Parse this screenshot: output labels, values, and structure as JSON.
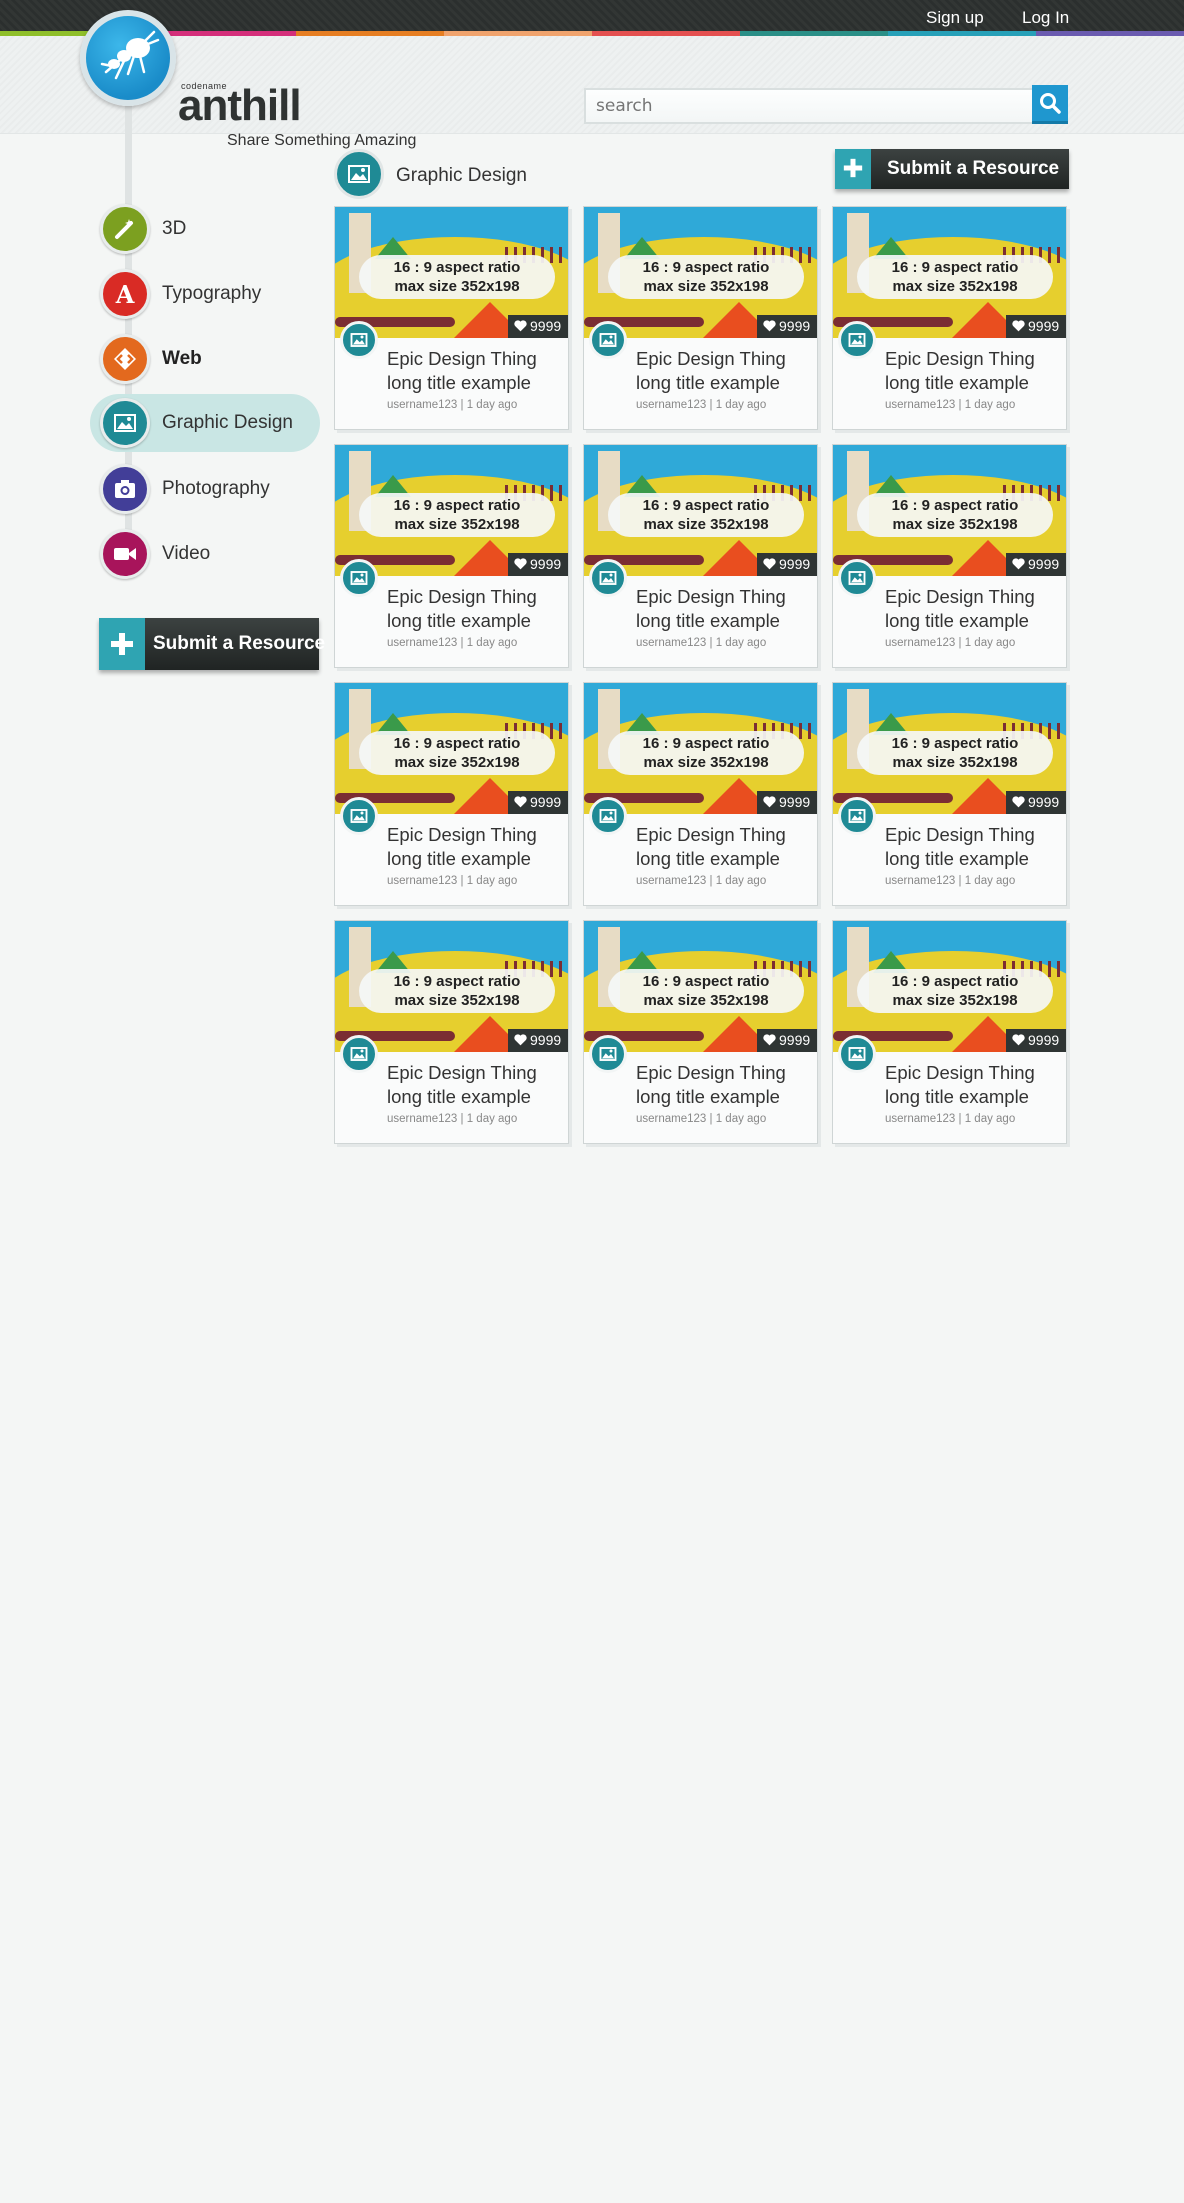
{
  "topbar": {
    "signup_label": "Sign up",
    "login_label": "Log In",
    "stripe_colors": [
      "#8fbf2a",
      "#d42f7b",
      "#e67e22",
      "#f0a36d",
      "#e45050",
      "#2a8f87",
      "#26a0b8",
      "#6a5bb0"
    ]
  },
  "header": {
    "logo_small": "codename",
    "logo_name": "anthill",
    "tagline": "Share Something Amazing",
    "search_placeholder": "search"
  },
  "sidebar": {
    "items": [
      {
        "label": "3D",
        "icon": "wand-icon",
        "color": "#7ca020"
      },
      {
        "label": "Typography",
        "icon": "letter-a-icon",
        "color": "#d92b25"
      },
      {
        "label": "Web",
        "icon": "code-diamond-icon",
        "color": "#e3691e"
      },
      {
        "label": "Graphic Design",
        "icon": "image-icon",
        "color": "#1f8a95"
      },
      {
        "label": "Photography",
        "icon": "camera-icon",
        "color": "#423e98"
      },
      {
        "label": "Video",
        "icon": "video-camera-icon",
        "color": "#a8145b"
      }
    ],
    "submit_label": "Submit a Resource"
  },
  "main": {
    "category_title": "Graphic Design",
    "submit_label": "Submit a Resource",
    "cards": [
      {
        "placeholder_line1": "16 : 9 aspect ratio",
        "placeholder_line2": "max size 352x198",
        "likes": "9999",
        "title": "Epic Design Thing long title example",
        "meta": "username123 | 1 day ago"
      },
      {
        "placeholder_line1": "16 : 9 aspect ratio",
        "placeholder_line2": "max size 352x198",
        "likes": "9999",
        "title": "Epic Design Thing long title example",
        "meta": "username123 | 1 day ago"
      },
      {
        "placeholder_line1": "16 : 9 aspect ratio",
        "placeholder_line2": "max size 352x198",
        "likes": "9999",
        "title": "Epic Design Thing long title example",
        "meta": "username123 | 1 day ago"
      },
      {
        "placeholder_line1": "16 : 9 aspect ratio",
        "placeholder_line2": "max size 352x198",
        "likes": "9999",
        "title": "Epic Design Thing long title example",
        "meta": "username123 | 1 day ago"
      },
      {
        "placeholder_line1": "16 : 9 aspect ratio",
        "placeholder_line2": "max size 352x198",
        "likes": "9999",
        "title": "Epic Design Thing long title example",
        "meta": "username123 | 1 day ago"
      },
      {
        "placeholder_line1": "16 : 9 aspect ratio",
        "placeholder_line2": "max size 352x198",
        "likes": "9999",
        "title": "Epic Design Thing long title example",
        "meta": "username123 | 1 day ago"
      },
      {
        "placeholder_line1": "16 : 9 aspect ratio",
        "placeholder_line2": "max size 352x198",
        "likes": "9999",
        "title": "Epic Design Thing long title example",
        "meta": "username123 | 1 day ago"
      },
      {
        "placeholder_line1": "16 : 9 aspect ratio",
        "placeholder_line2": "max size 352x198",
        "likes": "9999",
        "title": "Epic Design Thing long title example",
        "meta": "username123 | 1 day ago"
      },
      {
        "placeholder_line1": "16 : 9 aspect ratio",
        "placeholder_line2": "max size 352x198",
        "likes": "9999",
        "title": "Epic Design Thing long title example",
        "meta": "username123 | 1 day ago"
      },
      {
        "placeholder_line1": "16 : 9 aspect ratio",
        "placeholder_line2": "max size 352x198",
        "likes": "9999",
        "title": "Epic Design Thing long title example",
        "meta": "username123 | 1 day ago"
      },
      {
        "placeholder_line1": "16 : 9 aspect ratio",
        "placeholder_line2": "max size 352x198",
        "likes": "9999",
        "title": "Epic Design Thing long title example",
        "meta": "username123 | 1 day ago"
      },
      {
        "placeholder_line1": "16 : 9 aspect ratio",
        "placeholder_line2": "max size 352x198",
        "likes": "9999",
        "title": "Epic Design Thing long title example",
        "meta": "username123 | 1 day ago"
      }
    ]
  }
}
